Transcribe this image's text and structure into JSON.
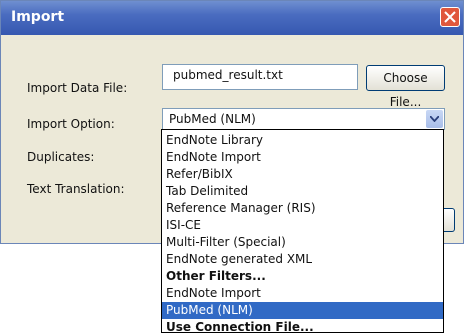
{
  "dialog": {
    "title": "Import",
    "labels": {
      "import_data_file": "Import Data File:",
      "import_option": "Import Option:",
      "duplicates": "Duplicates:",
      "text_translation": "Text Translation:"
    },
    "file_value": "pubmed_result.txt",
    "choose_file_label": "Choose File...",
    "import_option_value": "PubMed (NLM)"
  },
  "dropdown": {
    "options": [
      {
        "label": "EndNote Library"
      },
      {
        "label": "EndNote Import"
      },
      {
        "label": "Refer/BibIX"
      },
      {
        "label": "Tab Delimited"
      },
      {
        "label": "Reference Manager (RIS)"
      },
      {
        "label": "ISI-CE"
      },
      {
        "label": "Multi-Filter (Special)"
      },
      {
        "label": "EndNote generated XML"
      },
      {
        "label": "Other Filters..."
      },
      {
        "label": "EndNote Import"
      },
      {
        "label": "PubMed (NLM)"
      },
      {
        "label": "Use Connection File..."
      }
    ],
    "selected": "PubMed (NLM)"
  },
  "colors": {
    "titlebar": "#3658b0",
    "selection": "#316ac5",
    "close_button": "#e0573d"
  }
}
